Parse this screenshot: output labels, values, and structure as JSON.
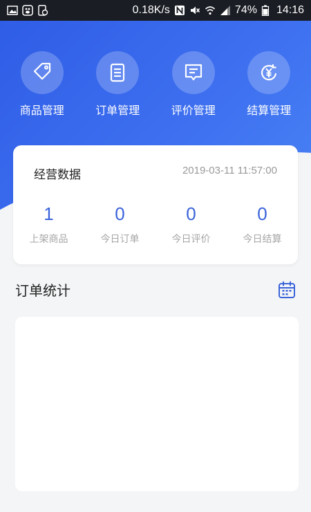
{
  "status_bar": {
    "speed": "0.18K/s",
    "battery": "74%",
    "time": "14:16"
  },
  "quick_actions": [
    {
      "label": "商品管理",
      "icon": "tag-icon"
    },
    {
      "label": "订单管理",
      "icon": "order-list-icon"
    },
    {
      "label": "评价管理",
      "icon": "comment-icon"
    },
    {
      "label": "结算管理",
      "icon": "yen-settlement-icon"
    }
  ],
  "overview": {
    "title": "经营数据",
    "timestamp": "2019-03-11 11:57:00",
    "stats": [
      {
        "value": "1",
        "label": "上架商品"
      },
      {
        "value": "0",
        "label": "今日订单"
      },
      {
        "value": "0",
        "label": "今日评价"
      },
      {
        "value": "0",
        "label": "今日结算"
      }
    ]
  },
  "orders": {
    "title": "订单统计"
  },
  "colors": {
    "brand_blue": "#3a63d9",
    "header_gradient_start": "#2f5de6",
    "header_gradient_end": "#4a86f5"
  }
}
